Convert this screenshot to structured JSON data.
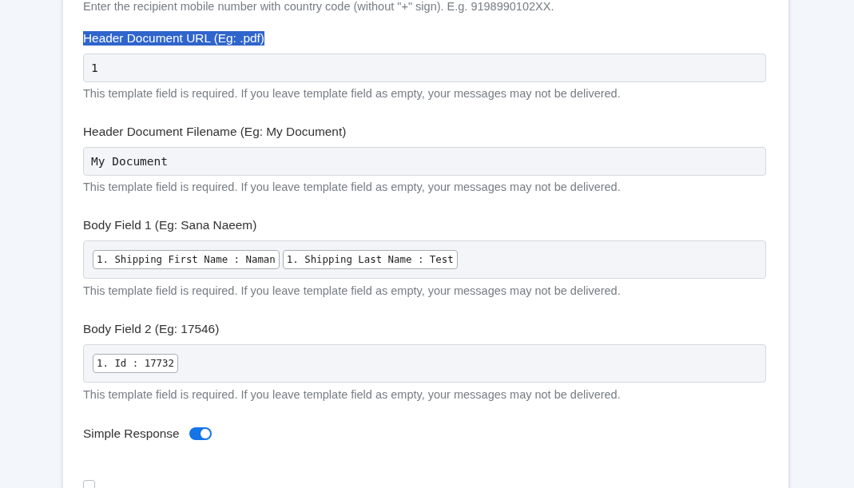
{
  "intro_hint": "Enter the recipient mobile number with country code (without \"+\" sign). E.g. 9198990102XX.",
  "fields": [
    {
      "kind": "text",
      "label": "Header Document URL (Eg: .pdf)",
      "highlighted": true,
      "value": "1",
      "help": "This template field is required. If you leave template field as empty, your messages may not be delivered."
    },
    {
      "kind": "text",
      "label": "Header Document Filename (Eg: My Document)",
      "highlighted": false,
      "value": "My Document",
      "help": "This template field is required. If you leave template field as empty, your messages may not be delivered."
    },
    {
      "kind": "tags",
      "label": "Body Field 1 (Eg: Sana Naeem)",
      "highlighted": false,
      "tags": [
        "1. Shipping First Name : Naman",
        "1. Shipping Last Name : Test"
      ],
      "help": "This template field is required. If you leave template field as empty, your messages may not be delivered."
    },
    {
      "kind": "tags",
      "label": "Body Field 2 (Eg: 17546)",
      "highlighted": false,
      "tags": [
        "1. Id : 17732"
      ],
      "help": "This template field is required. If you leave template field as empty, your messages may not be delivered."
    }
  ],
  "simple_response": {
    "label": "Simple Response",
    "on": true
  },
  "next_option": {
    "checked": false
  }
}
